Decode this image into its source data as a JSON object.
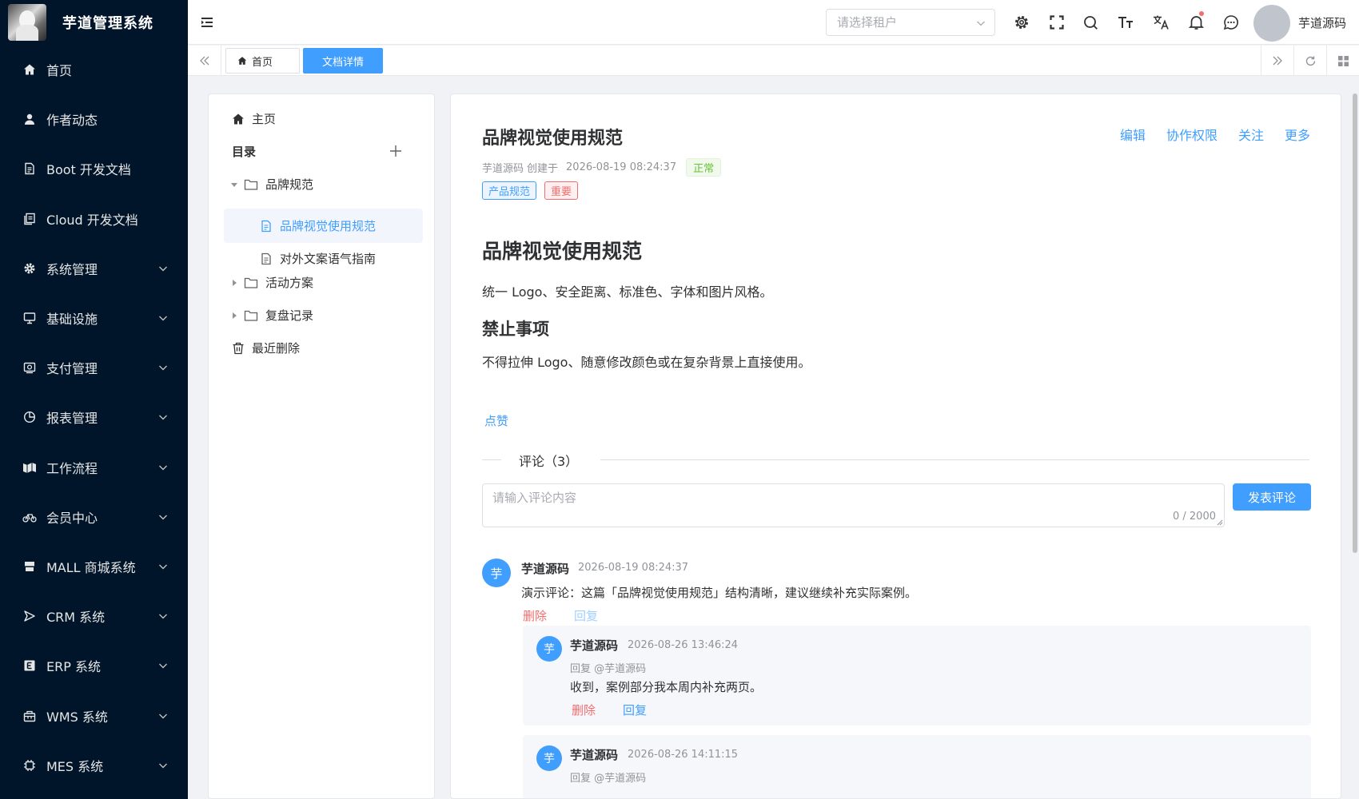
{
  "app": {
    "title": "芋道管理系统"
  },
  "sidebar": {
    "items": [
      {
        "label": "首页",
        "icon": "home-icon",
        "expandable": false
      },
      {
        "label": "作者动态",
        "icon": "user-icon",
        "expandable": false
      },
      {
        "label": "Boot 开发文档",
        "icon": "document-icon",
        "expandable": false
      },
      {
        "label": "Cloud 开发文档",
        "icon": "documents-icon",
        "expandable": false
      },
      {
        "label": "系统管理",
        "icon": "gear-icon",
        "expandable": true
      },
      {
        "label": "基础设施",
        "icon": "monitor-icon",
        "expandable": true
      },
      {
        "label": "支付管理",
        "icon": "payment-icon",
        "expandable": true
      },
      {
        "label": "报表管理",
        "icon": "pie-chart-icon",
        "expandable": true
      },
      {
        "label": "工作流程",
        "icon": "workflow-icon",
        "expandable": true
      },
      {
        "label": "会员中心",
        "icon": "bicycle-icon",
        "expandable": true
      },
      {
        "label": "MALL 商城系统",
        "icon": "shop-icon",
        "expandable": true
      },
      {
        "label": "CRM 系统",
        "icon": "crm-icon",
        "expandable": true
      },
      {
        "label": "ERP 系统",
        "icon": "erp-icon",
        "expandable": true
      },
      {
        "label": "WMS 系统",
        "icon": "warehouse-icon",
        "expandable": true
      },
      {
        "label": "MES 系统",
        "icon": "chip-icon",
        "expandable": true
      }
    ]
  },
  "header": {
    "tenant_placeholder": "请选择租户",
    "user_name": "芋道源码",
    "has_notification": true
  },
  "tabs": {
    "home_label": "首页",
    "active_label": "文档详情"
  },
  "tree": {
    "home_label": "主页",
    "catalog_label": "目录",
    "folders": [
      {
        "label": "品牌规范",
        "expanded": true,
        "docs": [
          "品牌视觉使用规范",
          "对外文案语气指南"
        ]
      },
      {
        "label": "活动方案",
        "expanded": false
      },
      {
        "label": "复盘记录",
        "expanded": false
      }
    ],
    "selected_doc": "品牌视觉使用规范",
    "trash_label": "最近删除"
  },
  "doc": {
    "title": "品牌视觉使用规范",
    "actions": [
      "编辑",
      "协作权限",
      "关注",
      "更多"
    ],
    "author": "芋道源码",
    "created_label": "创建于",
    "created_time": "2026-08-19 08:24:37",
    "status": "正常",
    "tags": [
      "产品规范",
      "重要"
    ],
    "heading1": "品牌视觉使用规范",
    "paragraph1": "统一 Logo、安全距离、标准色、字体和图片风格。",
    "heading2": "禁止事项",
    "paragraph2": "不得拉伸 Logo、随意修改颜色或在复杂背景上直接使用。",
    "like_label": "点赞"
  },
  "comments": {
    "title": "评论（3）",
    "input_placeholder": "请输入评论内容",
    "char_count": "0 / 2000",
    "submit_label": "发表评论",
    "list": [
      {
        "avatar_char": "芋",
        "author": "芋道源码",
        "time": "2026-08-19 08:24:37",
        "text": "演示评论：这篇「品牌视觉使用规范」结构清晰，建议继续补充实际案例。",
        "delete_label": "删除",
        "reply_label": "回复"
      },
      {
        "avatar_char": "芋",
        "author": "芋道源码",
        "time": "2026-08-26 13:46:24",
        "reply_to": "回复 @芋道源码",
        "text": "收到，案例部分我本周内补充两页。",
        "delete_label": "删除",
        "reply_label": "回复"
      },
      {
        "avatar_char": "芋",
        "author": "芋道源码",
        "time": "2026-08-26 14:11:15",
        "reply_to": "回复 @芋道源码"
      }
    ]
  },
  "colors": {
    "sidebar_bg": "#001529",
    "primary": "#409eff",
    "danger": "#f56c6c",
    "success": "#67c23a"
  }
}
